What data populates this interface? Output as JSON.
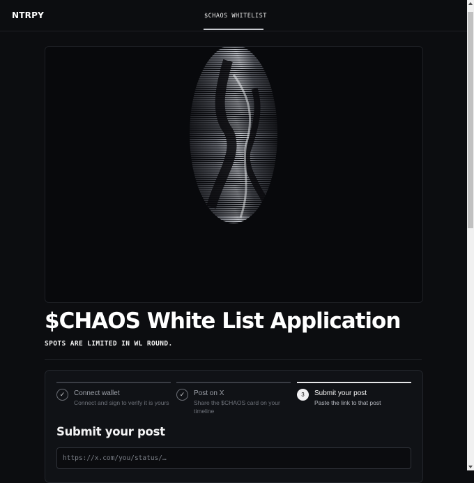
{
  "header": {
    "logo": "NTRPY",
    "nav_tab": "$CHAOS WHITELIST"
  },
  "hero": {
    "image_name": "glitch-coin-figure"
  },
  "main": {
    "title": "$CHAOS White List Application",
    "subtitle": "SPOTS ARE LIMITED IN WL ROUND."
  },
  "steps": [
    {
      "check": "✓",
      "title": "Connect wallet",
      "desc": "Connect and sign to verify it is yours",
      "state": "done"
    },
    {
      "check": "✓",
      "title": "Post on X",
      "desc": "Share the $CHAOS card on your timeline",
      "state": "done"
    },
    {
      "check": "3",
      "title": "Submit your post",
      "desc": "Paste the link to that post",
      "state": "active"
    }
  ],
  "form": {
    "title": "Submit your post",
    "placeholder": "https://x.com/you/status/…",
    "value": ""
  },
  "colors": {
    "background": "#0c0d10",
    "card": "#101216",
    "accent": "#f1f1f3",
    "muted": "#6f737b"
  }
}
